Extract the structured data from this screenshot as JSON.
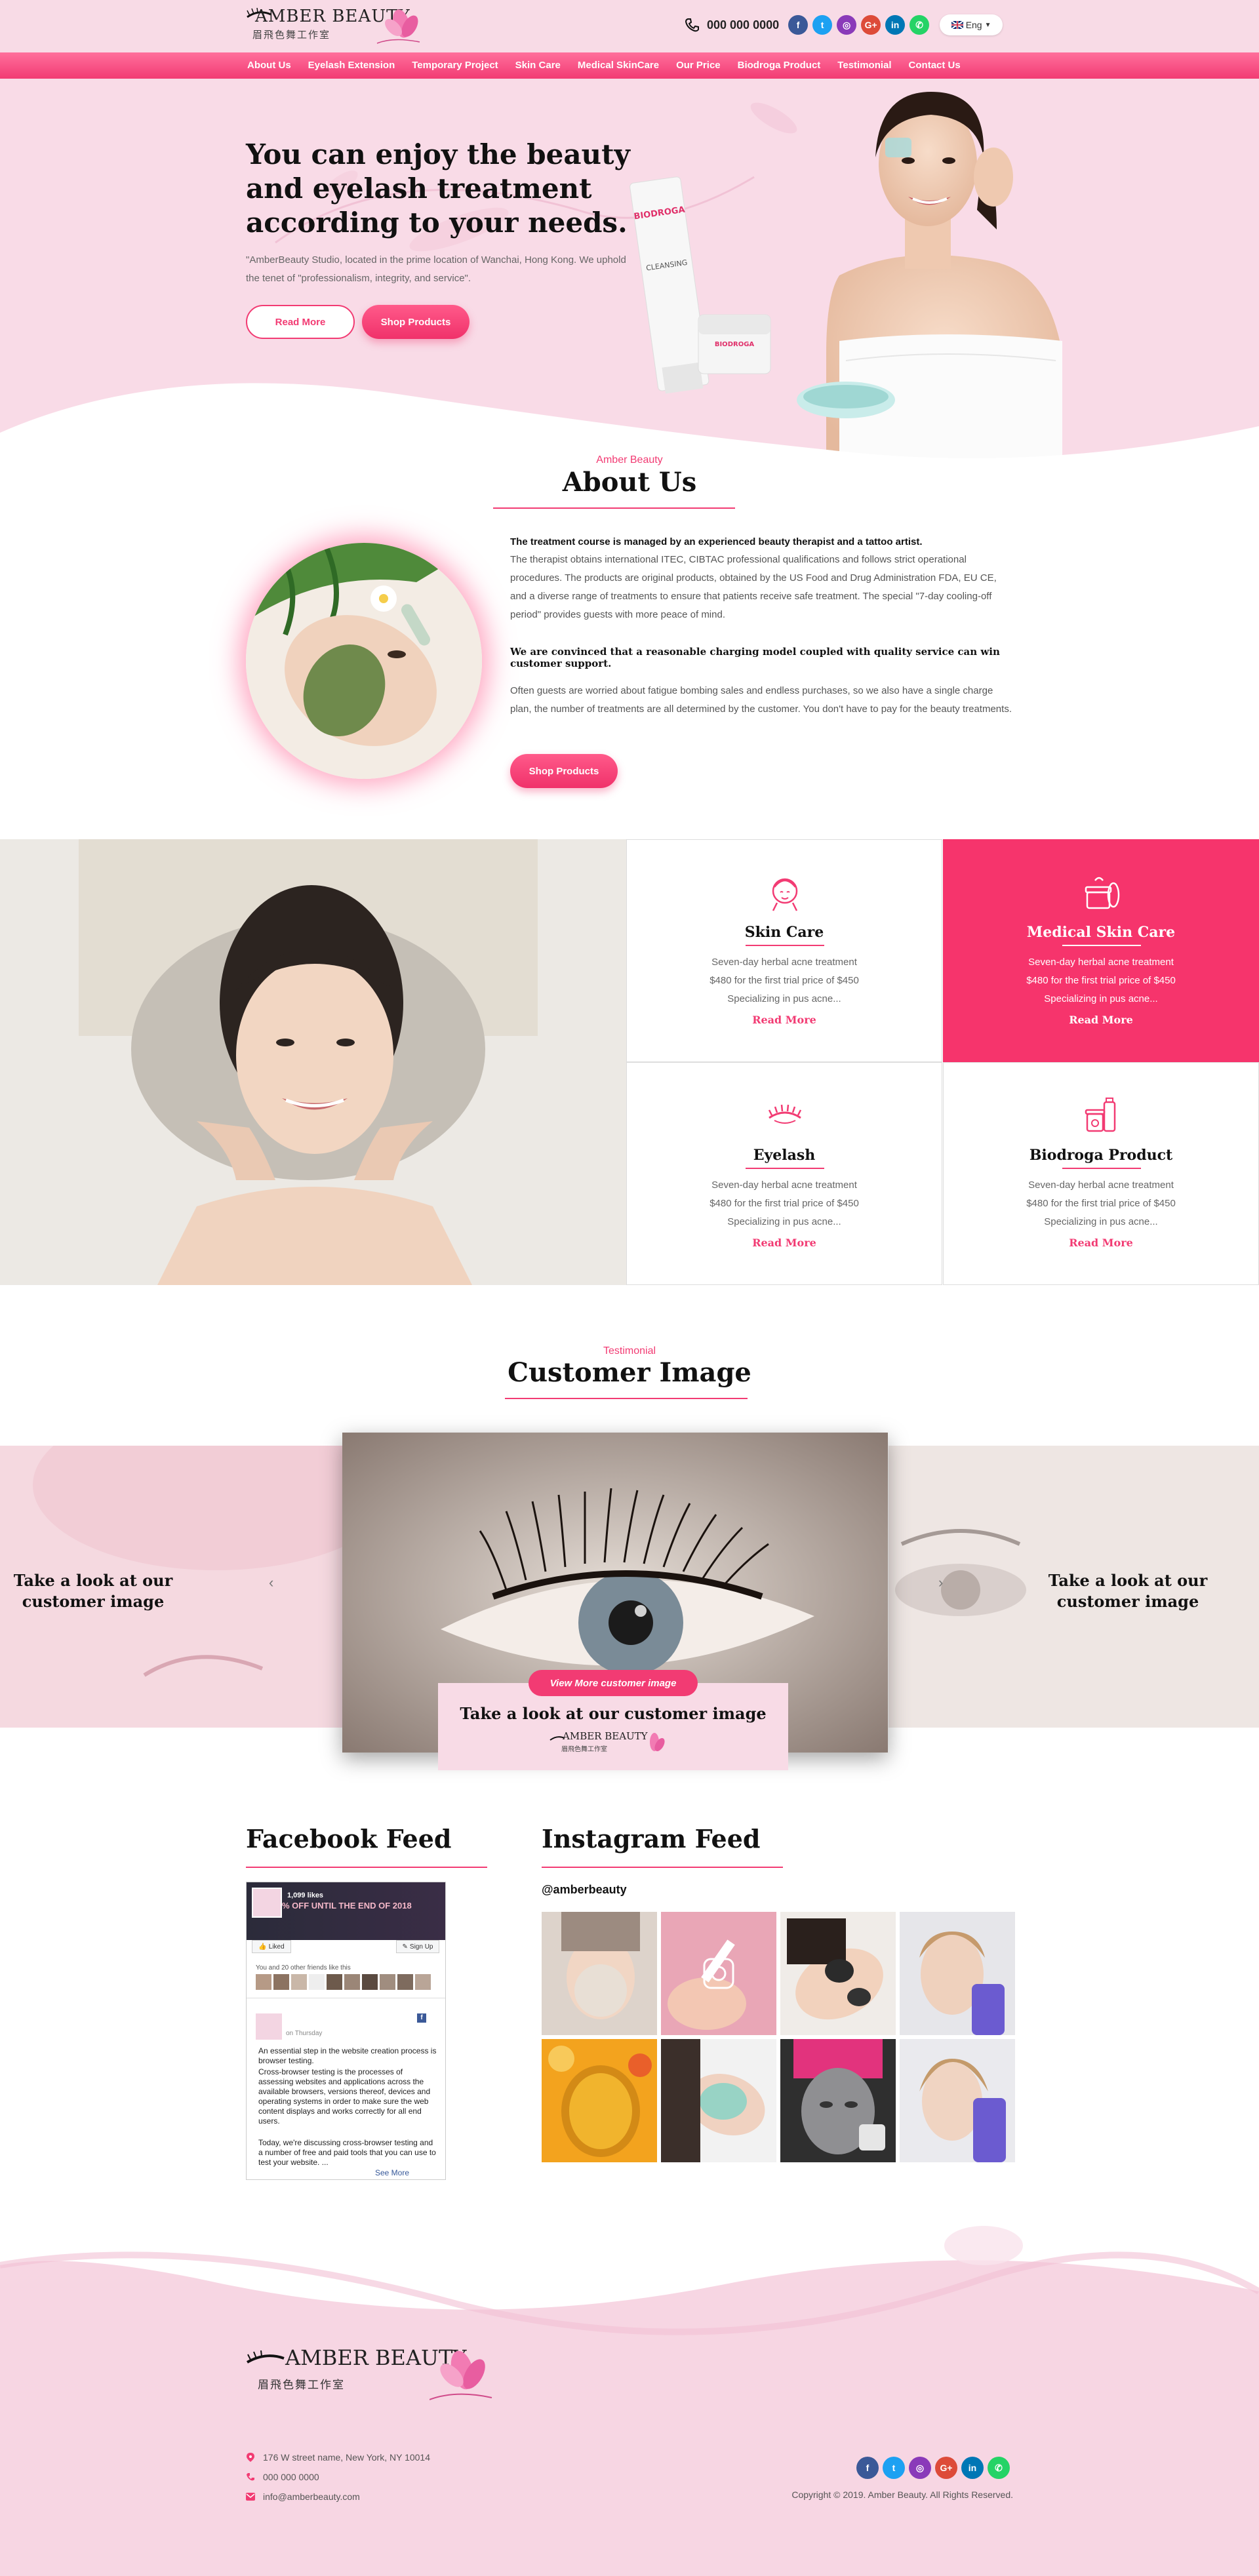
{
  "header": {
    "logo_title": "AMBER BEAUTY",
    "logo_subtitle": "眉飛色舞工作室",
    "phone": "000 000 0000",
    "language": "Eng",
    "socials": [
      {
        "icon": "facebook-icon",
        "glyph": "f",
        "color": "#3b5998"
      },
      {
        "icon": "twitter-icon",
        "glyph": "t",
        "color": "#1da1f2"
      },
      {
        "icon": "instagram-icon",
        "glyph": "◎",
        "color": "#8a3ab9"
      },
      {
        "icon": "google-plus-icon",
        "glyph": "G+",
        "color": "#dd4b39"
      },
      {
        "icon": "linkedin-icon",
        "glyph": "in",
        "color": "#0077b5"
      },
      {
        "icon": "whatsapp-icon",
        "glyph": "✆",
        "color": "#25d366"
      }
    ]
  },
  "nav": [
    "About Us",
    "Eyelash Extension",
    "Temporary Project",
    "Skin Care",
    "Medical SkinCare",
    "Our Price",
    "Biodroga Product",
    "Testimonial",
    "Contact Us"
  ],
  "hero": {
    "title": "You can enjoy the beauty and eyelash treatment according to your needs.",
    "text": "\"AmberBeauty Studio, located in the prime location of Wanchai, Hong Kong. We uphold the tenet of \"professionalism, integrity, and service\".",
    "read_more": "Read More",
    "shop": "Shop Products",
    "product_brand": "BIODROGA",
    "product_name": "CLEANSING"
  },
  "about": {
    "kicker": "Amber Beauty",
    "title": "About Us",
    "p1_bold": "The treatment course is managed by an experienced beauty therapist and a tattoo artist.",
    "p1": "The therapist obtains international ITEC, CIBTAC professional qualifications and follows strict operational procedures. The products are original products, obtained by the US Food and Drug Administration FDA, EU CE, and a diverse range of treatments to ensure that patients receive safe treatment. The special \"7-day cooling-off period\" provides guests with more peace of mind.",
    "p2_bold": "We are convinced that a reasonable charging model coupled with quality service can win customer support.",
    "p3": "Often guests are worried about fatigue bombing sales and endless purchases, so we also have a single charge plan, the number of treatments are all determined by the customer. You don't have to pay for the beauty treatments.",
    "shop": "Shop Products"
  },
  "services": [
    {
      "title": "Skin Care",
      "icon": "face-icon",
      "lines": [
        "Seven-day herbal acne treatment",
        "$480 for the first trial price of $450",
        "Specializing in pus acne..."
      ],
      "more": "Read More"
    },
    {
      "title": "Medical Skin Care",
      "icon": "cream-jar-icon",
      "lines": [
        "Seven-day herbal acne treatment",
        "$480 for the first trial price of $450",
        "Specializing in pus acne..."
      ],
      "more": "Read More"
    },
    {
      "title": "Eyelash",
      "icon": "eyelash-icon",
      "lines": [
        "Seven-day herbal acne treatment",
        "$480 for the first trial price of $450",
        "Specializing in pus acne..."
      ],
      "more": "Read More"
    },
    {
      "title": "Biodroga Product",
      "icon": "product-bottle-icon",
      "lines": [
        "Seven-day herbal acne treatment",
        "$480 for the first trial price of $450",
        "Specializing in pus acne..."
      ],
      "more": "Read More"
    }
  ],
  "testimonial": {
    "kicker": "Testimonial",
    "title": "Customer Image",
    "side_text": "Take a look at our customer image",
    "button": "View More customer image",
    "caption": "Take a look at our customer image"
  },
  "facebook": {
    "title": "Facebook Feed",
    "likes": "1,099 likes",
    "banner": "% OFF UNTIL THE END OF 2018",
    "liked": "Liked",
    "signup": "Sign Up",
    "friends": "You and 20 other friends like this",
    "when": "on Thursday",
    "post1": "An essential step in the website creation process is browser testing.",
    "post2": "Cross-browser testing is the processes of assessing websites and applications across the available browsers, versions thereof, devices and operating systems in order to make sure the web content displays and works correctly for all end users.",
    "post3": "Today, we're discussing cross-browser testing and a number of free and paid tools that you can use to test your website. ...",
    "see_more": "See More"
  },
  "instagram": {
    "title": "Instagram Feed",
    "handle": "@amberbeauty"
  },
  "footer": {
    "address": "176 W street name, New York, NY 10014",
    "phone": "000 000 0000",
    "email": "info@amberbeauty.com",
    "copyright": "Copyright © 2019. Amber Beauty. All Rights Reserved."
  },
  "colors": {
    "accent": "#f23b73",
    "pink_bg": "#f9dbe7"
  }
}
